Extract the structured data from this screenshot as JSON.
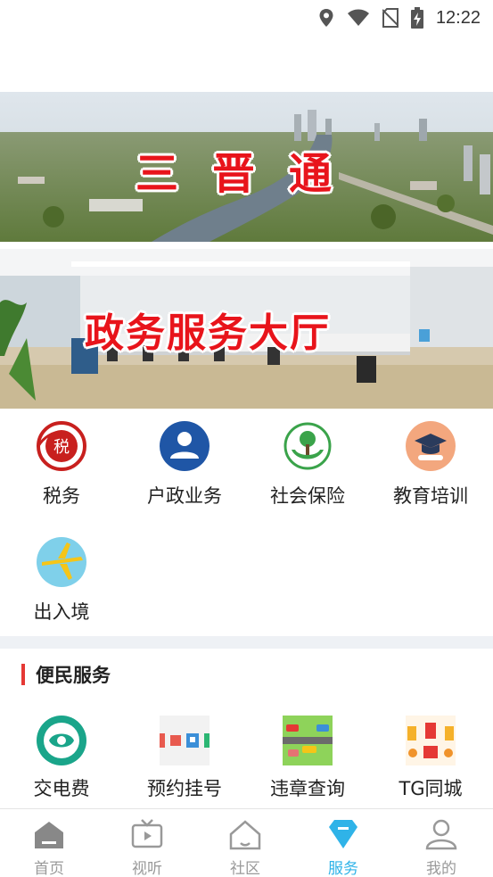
{
  "status_bar": {
    "time": "12:22"
  },
  "banner": {
    "title_top": "三晋通",
    "title_bottom": "政务服务大厅"
  },
  "gov_services": [
    {
      "label": "税务",
      "icon": "tax-icon"
    },
    {
      "label": "户政业务",
      "icon": "household-icon"
    },
    {
      "label": "社会保险",
      "icon": "social-insurance-icon"
    },
    {
      "label": "教育培训",
      "icon": "education-icon"
    },
    {
      "label": "出入境",
      "icon": "airplane-icon"
    }
  ],
  "convenience": {
    "title": "便民服务",
    "items": [
      {
        "label": "交电费",
        "icon": "electricity-icon"
      },
      {
        "label": "预约挂号",
        "icon": "appointment-icon"
      },
      {
        "label": "违章查询",
        "icon": "traffic-violation-icon"
      },
      {
        "label": "TG同城",
        "icon": "tg-city-icon"
      }
    ]
  },
  "tab_bar": {
    "active": "服务",
    "tabs": [
      {
        "label": "首页",
        "icon": "home-icon"
      },
      {
        "label": "视听",
        "icon": "tv-icon"
      },
      {
        "label": "社区",
        "icon": "community-icon"
      },
      {
        "label": "服务",
        "icon": "service-icon"
      },
      {
        "label": "我的",
        "icon": "profile-icon"
      }
    ]
  },
  "colors": {
    "accent": "#2fb3e8",
    "section_bar": "#e53935",
    "banner_text": "#e8141b"
  }
}
